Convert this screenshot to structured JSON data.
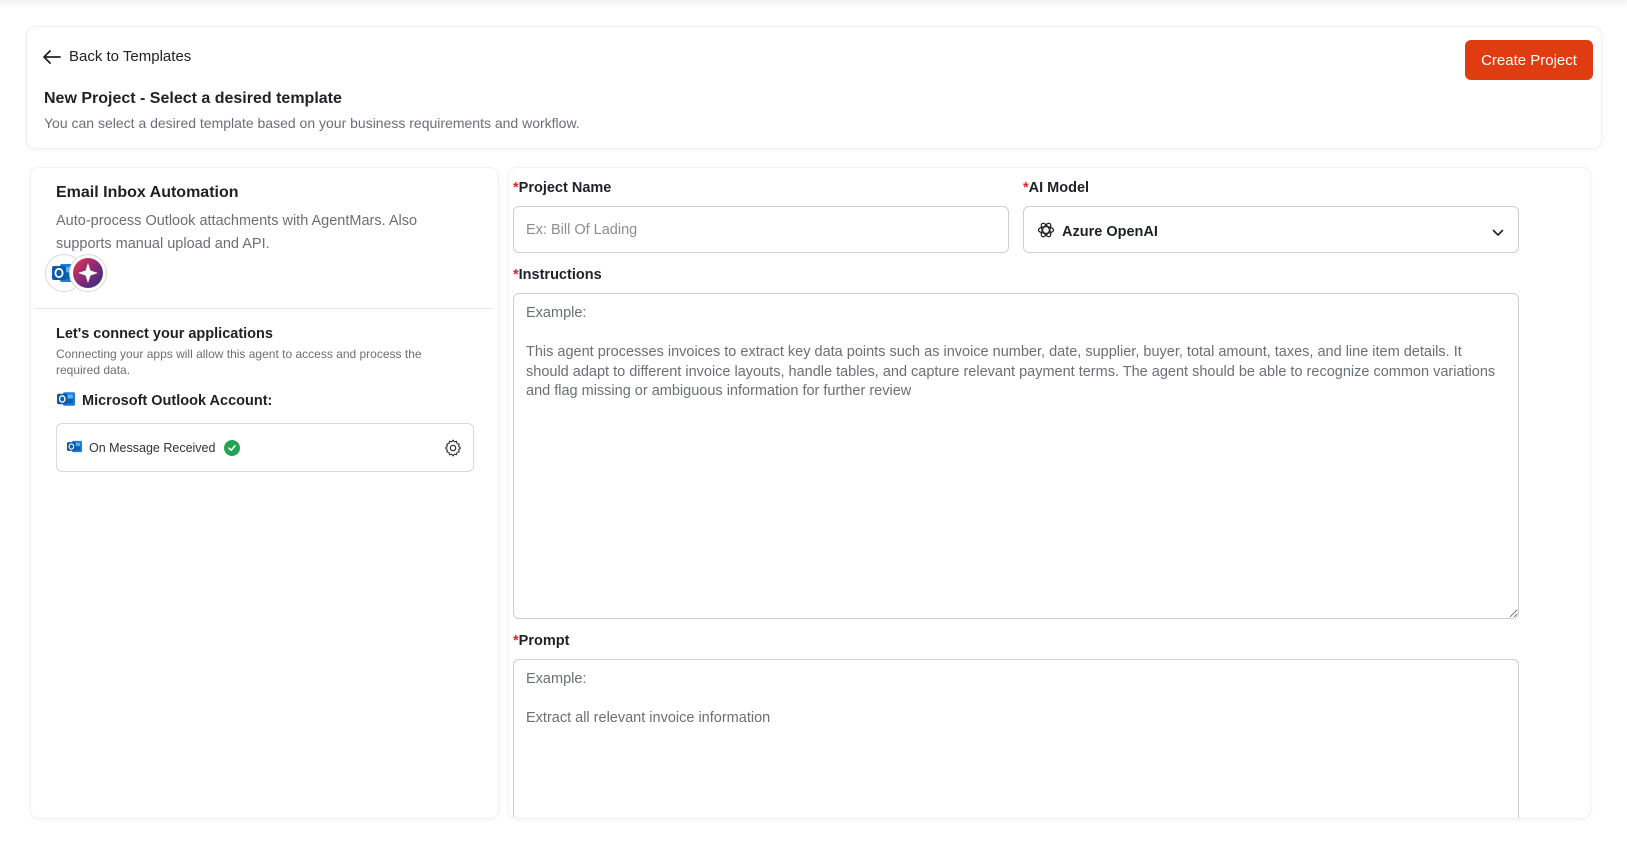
{
  "header": {
    "back_label": "Back to Templates",
    "title": "New Project - Select a desired template",
    "subtitle": "You can select a desired template based on your business requirements and workflow.",
    "create_button": "Create Project"
  },
  "template": {
    "title": "Email Inbox Automation",
    "description": "Auto-process Outlook attachments with AgentMars. Also supports manual upload and API.",
    "icons": [
      "outlook-icon",
      "agentmars-icon"
    ]
  },
  "connect": {
    "title": "Let's connect your applications",
    "description": "Connecting your apps will allow this agent to access and process the required data.",
    "account_label": "Microsoft Outlook Account:",
    "trigger_label": "On Message Received",
    "trigger_status": "connected"
  },
  "form": {
    "required_mark": "*",
    "project_name": {
      "label": "Project Name",
      "placeholder": "Ex: Bill Of Lading",
      "value": ""
    },
    "ai_model": {
      "label": "AI Model",
      "selected": "Azure OpenAI"
    },
    "instructions": {
      "label": "Instructions",
      "placeholder": "Example:\n\nThis agent processes invoices to extract key data points such as invoice number, date, supplier, buyer, total amount, taxes, and line item details. It should adapt to different invoice layouts, handle tables, and capture relevant payment terms. The agent should be able to recognize common variations and flag missing or ambiguous information for further review",
      "value": ""
    },
    "prompt": {
      "label": "Prompt",
      "placeholder": "Example:\n\nExtract all relevant invoice information",
      "value": ""
    }
  },
  "colors": {
    "accent": "#e03c12",
    "required": "#e0242a",
    "success": "#23a455"
  }
}
